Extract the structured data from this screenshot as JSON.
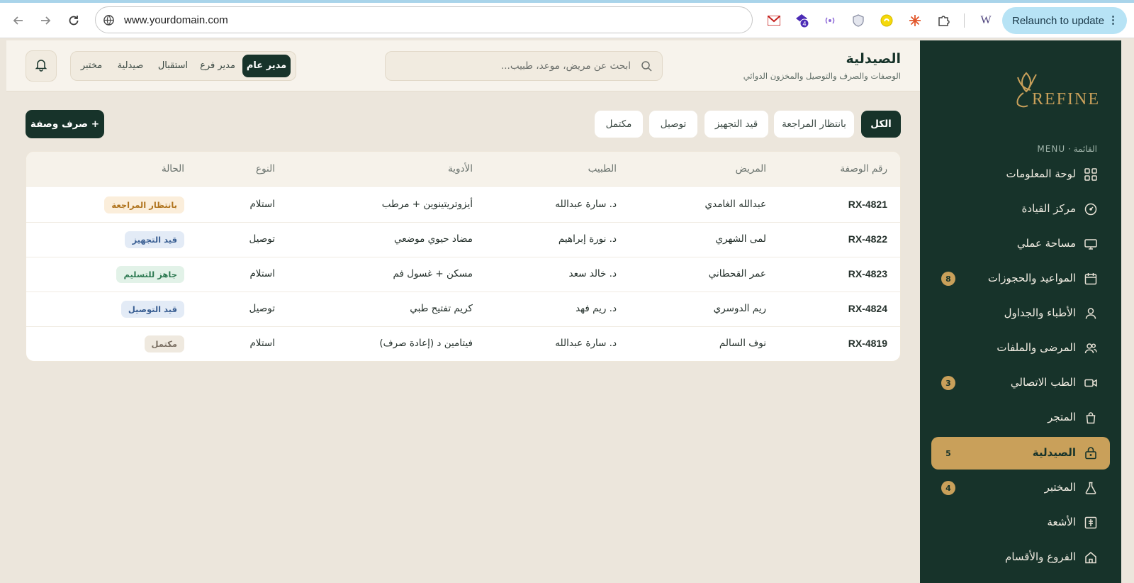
{
  "browser": {
    "url": "www.yourdomain.com",
    "relaunch_label": "Relaunch to update",
    "extensions": [
      {
        "name": "gmail-icon",
        "color": "#c5221f"
      },
      {
        "name": "extension-badge-icon",
        "color": "#4b2bb5",
        "badge": "4"
      },
      {
        "name": "broadcast-icon",
        "color": "#8e6bd8"
      },
      {
        "name": "shield-icon",
        "color": "#8a8fa3"
      },
      {
        "name": "snapchat-icon",
        "color": "#f5d90a"
      },
      {
        "name": "sparkle-icon",
        "color": "#e2572b"
      },
      {
        "name": "puzzle-icon",
        "color": "#444444"
      },
      {
        "name": "w-icon",
        "color": "#4a3f7a",
        "text": "W"
      }
    ]
  },
  "header": {
    "title": "الصيدلية",
    "subtitle": "الوصفات والصرف والتوصيل والمخزون الدوائي",
    "search_placeholder": "ابحث عن مريض، موعد، طبيب...",
    "roles": [
      "مدير عام",
      "مدير فرع",
      "استقبال",
      "صيدلية",
      "مختبر"
    ],
    "active_role": "مدير عام"
  },
  "sidebar": {
    "logo_text": "REFINE",
    "menu_caption": "القائمة · MENU",
    "items": [
      {
        "label": "لوحة المعلومات",
        "icon": "dashboard-icon",
        "badge": ""
      },
      {
        "label": "مركز القيادة",
        "icon": "gauge-icon",
        "badge": ""
      },
      {
        "label": "مساحة عملي",
        "icon": "monitor-icon",
        "badge": ""
      },
      {
        "label": "المواعيد والحجوزات",
        "icon": "calendar-icon",
        "badge": "8"
      },
      {
        "label": "الأطباء والجداول",
        "icon": "user-icon",
        "badge": ""
      },
      {
        "label": "المرضى والملفات",
        "icon": "users-icon",
        "badge": ""
      },
      {
        "label": "الطب الاتصالي",
        "icon": "video-icon",
        "badge": "3"
      },
      {
        "label": "المتجر",
        "icon": "bag-icon",
        "badge": ""
      },
      {
        "label": "الصيدلية",
        "icon": "lock-bag-icon",
        "badge": "5"
      },
      {
        "label": "المختبر",
        "icon": "flask-icon",
        "badge": "4"
      },
      {
        "label": "الأشعة",
        "icon": "xray-icon",
        "badge": ""
      },
      {
        "label": "الفروع والأقسام",
        "icon": "home-icon",
        "badge": ""
      }
    ],
    "active_index": 8
  },
  "content": {
    "add_button": "+ صرف وصفة",
    "filters": [
      "الكل",
      "بانتظار المراجعة",
      "قيد التجهيز",
      "توصيل",
      "مكتمل"
    ],
    "active_filter": "الكل",
    "columns": [
      "رقم الوصفة",
      "المريض",
      "الطبيب",
      "الأدوية",
      "النوع",
      "الحالة"
    ],
    "rows": [
      {
        "rx": "RX-4821",
        "patient": "عبدالله الغامدي",
        "doctor": "د. سارة عبدالله",
        "meds": "أيزوتريتينوين + مرطب",
        "type": "استلام",
        "status": "بانتظار المراجعة",
        "status_color": "#b0741e",
        "status_bg": "#fbeedb"
      },
      {
        "rx": "RX-4822",
        "patient": "لمى الشهري",
        "doctor": "د. نورة إبراهيم",
        "meds": "مضاد حيوي موضعي",
        "type": "توصيل",
        "status": "قيد التجهيز",
        "status_color": "#3a5f93",
        "status_bg": "#e3ebf6"
      },
      {
        "rx": "RX-4823",
        "patient": "عمر القحطاني",
        "doctor": "د. خالد سعد",
        "meds": "مسكن + غسول فم",
        "type": "استلام",
        "status": "جاهز للتسليم",
        "status_color": "#2e7a52",
        "status_bg": "#e2f2e8"
      },
      {
        "rx": "RX-4824",
        "patient": "ريم الدوسري",
        "doctor": "د. ريم فهد",
        "meds": "كريم تفتيح طبي",
        "type": "توصيل",
        "status": "قيد التوصيل",
        "status_color": "#3a5f93",
        "status_bg": "#e3ebf6"
      },
      {
        "rx": "RX-4819",
        "patient": "نوف السالم",
        "doctor": "د. سارة عبدالله",
        "meds": "فيتامين د (إعادة صرف)",
        "type": "استلام",
        "status": "مكتمل",
        "status_color": "#7a6f62",
        "status_bg": "#efe9df"
      }
    ]
  }
}
